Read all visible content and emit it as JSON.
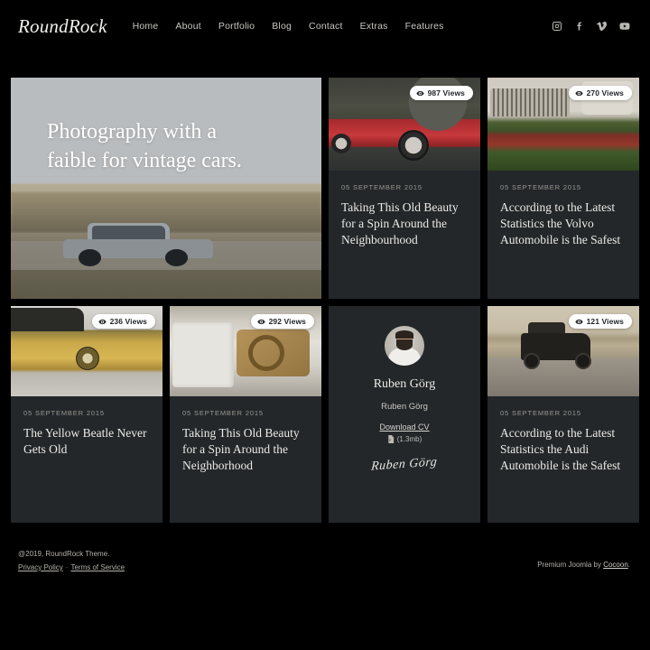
{
  "header": {
    "brand": "RoundRock",
    "nav": [
      {
        "label": "Home"
      },
      {
        "label": "About"
      },
      {
        "label": "Portfolio"
      },
      {
        "label": "Blog"
      },
      {
        "label": "Contact"
      },
      {
        "label": "Extras"
      },
      {
        "label": "Features"
      }
    ],
    "social": [
      {
        "name": "instagram-icon"
      },
      {
        "name": "facebook-icon"
      },
      {
        "name": "vimeo-icon"
      },
      {
        "name": "youtube-icon"
      }
    ]
  },
  "hero": {
    "title_line1": "Photography with a",
    "title_line2": "faible for vintage cars."
  },
  "cards": [
    {
      "views": "987 Views",
      "date": "05 SEPTEMBER 2015",
      "title": "Taking This Old Beauty for a Spin Around the Neighbourhood"
    },
    {
      "views": "270 Views",
      "date": "05 SEPTEMBER 2015",
      "title": "According to the Latest Statistics the Volvo Automobile is the Safest"
    },
    {
      "views": "236 Views",
      "date": "05 SEPTEMBER 2015",
      "title": "The Yellow Beatle Never Gets Old"
    },
    {
      "views": "292 Views",
      "date": "05 SEPTEMBER 2015",
      "title": "Taking This Old Beauty for a Spin Around the Neighborhood"
    },
    {
      "views": "121 Views",
      "date": "05 SEPTEMBER 2015",
      "title": "According to the Latest Statistics the Audi Automobile is the Safest"
    }
  ],
  "author": {
    "name": "Ruben Görg",
    "subtitle": "Ruben Görg",
    "cv_label": "Download CV",
    "cv_size": "(1.3mb)",
    "signature": "Ruben Görg"
  },
  "footer": {
    "copyright": "@2019, RoundRock Theme.",
    "privacy": "Privacy Policy",
    "separator": "·",
    "terms": "Terms of Service",
    "credit_prefix": "Premium Joomla by ",
    "credit_link": "Cocoon",
    "credit_suffix": "."
  },
  "colors": {
    "page_bg": "#000000",
    "card_bg": "#23272a",
    "text": "#eceae6",
    "muted": "#9b9893",
    "badge_bg": "#ffffff"
  }
}
